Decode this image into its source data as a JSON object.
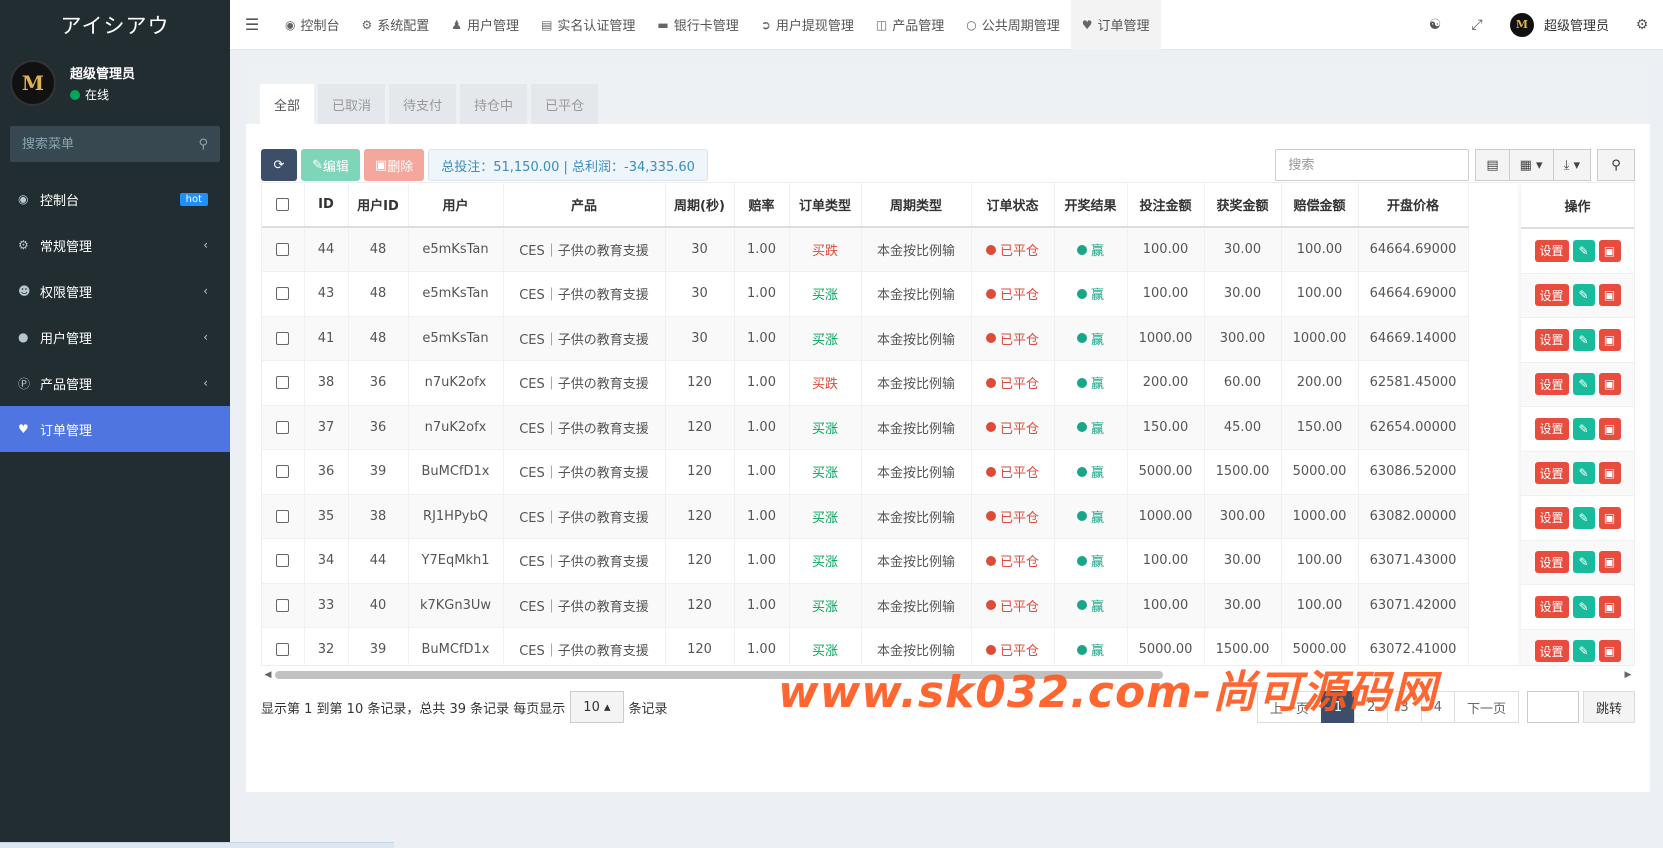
{
  "app": {
    "brand": "アイシアウ"
  },
  "sidebar": {
    "user": {
      "name": "超级管理员",
      "status": "在线",
      "avatar_letter": "M"
    },
    "search_placeholder": "搜索菜单",
    "items": [
      {
        "label": "控制台",
        "icon": "dashboard-icon",
        "badge": "hot"
      },
      {
        "label": "常规管理",
        "icon": "cogs-icon"
      },
      {
        "label": "权限管理",
        "icon": "users-icon"
      },
      {
        "label": "用户管理",
        "icon": "user-circle-icon"
      },
      {
        "label": "产品管理",
        "icon": "product-icon"
      },
      {
        "label": "订单管理",
        "icon": "heartbeat-icon",
        "active": true
      }
    ]
  },
  "topnav": {
    "tabs": [
      {
        "label": "控制台",
        "icon": "dashboard-icon"
      },
      {
        "label": "系统配置",
        "icon": "gear-icon"
      },
      {
        "label": "用户管理",
        "icon": "user-icon"
      },
      {
        "label": "实名认证管理",
        "icon": "id-card-icon"
      },
      {
        "label": "银行卡管理",
        "icon": "credit-card-icon"
      },
      {
        "label": "用户提现管理",
        "icon": "sign-out-icon"
      },
      {
        "label": "产品管理",
        "icon": "shopping-bag-icon"
      },
      {
        "label": "公共周期管理",
        "icon": "circle-icon"
      },
      {
        "label": "订单管理",
        "icon": "heartbeat-icon",
        "active": true
      }
    ],
    "user_name": "超级管理员"
  },
  "subtabs": [
    "全部",
    "已取消",
    "待支付",
    "持仓中",
    "已平仓"
  ],
  "toolbar": {
    "edit_label": "编辑",
    "delete_label": "删除",
    "summary": "总投注：51,150.00 | 总利润：-34,335.60",
    "search_placeholder": "搜索"
  },
  "table": {
    "columns": [
      "ID",
      "用户ID",
      "用户",
      "产品",
      "周期(秒)",
      "赔率",
      "订单类型",
      "周期类型",
      "订单状态",
      "开奖结果",
      "投注金额",
      "获奖金额",
      "赔偿金额",
      "开盘价格"
    ],
    "op_header": "操作",
    "op_set_label": "设置",
    "rows": [
      {
        "id": "44",
        "uid": "48",
        "user": "e5mKsTan",
        "product": "CES｜子供の教育支援",
        "period": "30",
        "odds": "1.00",
        "type": "买跌",
        "type_kind": "fall",
        "cycle": "本金按比例输",
        "status": "已平仓",
        "result": "赢",
        "bet": "100.00",
        "win": "30.00",
        "comp": "100.00",
        "open": "64664.69000"
      },
      {
        "id": "43",
        "uid": "48",
        "user": "e5mKsTan",
        "product": "CES｜子供の教育支援",
        "period": "30",
        "odds": "1.00",
        "type": "买涨",
        "type_kind": "rise",
        "cycle": "本金按比例输",
        "status": "已平仓",
        "result": "赢",
        "bet": "100.00",
        "win": "30.00",
        "comp": "100.00",
        "open": "64664.69000"
      },
      {
        "id": "41",
        "uid": "48",
        "user": "e5mKsTan",
        "product": "CES｜子供の教育支援",
        "period": "30",
        "odds": "1.00",
        "type": "买涨",
        "type_kind": "rise",
        "cycle": "本金按比例输",
        "status": "已平仓",
        "result": "赢",
        "bet": "1000.00",
        "win": "300.00",
        "comp": "1000.00",
        "open": "64669.14000"
      },
      {
        "id": "38",
        "uid": "36",
        "user": "n7uK2ofx",
        "product": "CES｜子供の教育支援",
        "period": "120",
        "odds": "1.00",
        "type": "买跌",
        "type_kind": "fall",
        "cycle": "本金按比例输",
        "status": "已平仓",
        "result": "赢",
        "bet": "200.00",
        "win": "60.00",
        "comp": "200.00",
        "open": "62581.45000"
      },
      {
        "id": "37",
        "uid": "36",
        "user": "n7uK2ofx",
        "product": "CES｜子供の教育支援",
        "period": "120",
        "odds": "1.00",
        "type": "买涨",
        "type_kind": "rise",
        "cycle": "本金按比例输",
        "status": "已平仓",
        "result": "赢",
        "bet": "150.00",
        "win": "45.00",
        "comp": "150.00",
        "open": "62654.00000"
      },
      {
        "id": "36",
        "uid": "39",
        "user": "BuMCfD1x",
        "product": "CES｜子供の教育支援",
        "period": "120",
        "odds": "1.00",
        "type": "买涨",
        "type_kind": "rise",
        "cycle": "本金按比例输",
        "status": "已平仓",
        "result": "赢",
        "bet": "5000.00",
        "win": "1500.00",
        "comp": "5000.00",
        "open": "63086.52000"
      },
      {
        "id": "35",
        "uid": "38",
        "user": "RJ1HPybQ",
        "product": "CES｜子供の教育支援",
        "period": "120",
        "odds": "1.00",
        "type": "买涨",
        "type_kind": "rise",
        "cycle": "本金按比例输",
        "status": "已平仓",
        "result": "赢",
        "bet": "1000.00",
        "win": "300.00",
        "comp": "1000.00",
        "open": "63082.00000"
      },
      {
        "id": "34",
        "uid": "44",
        "user": "Y7EqMkh1",
        "product": "CES｜子供の教育支援",
        "period": "120",
        "odds": "1.00",
        "type": "买涨",
        "type_kind": "rise",
        "cycle": "本金按比例输",
        "status": "已平仓",
        "result": "赢",
        "bet": "100.00",
        "win": "30.00",
        "comp": "100.00",
        "open": "63071.43000"
      },
      {
        "id": "33",
        "uid": "40",
        "user": "k7KGn3Uw",
        "product": "CES｜子供の教育支援",
        "period": "120",
        "odds": "1.00",
        "type": "买涨",
        "type_kind": "rise",
        "cycle": "本金按比例输",
        "status": "已平仓",
        "result": "赢",
        "bet": "100.00",
        "win": "30.00",
        "comp": "100.00",
        "open": "63071.42000"
      },
      {
        "id": "32",
        "uid": "39",
        "user": "BuMCfD1x",
        "product": "CES｜子供の教育支援",
        "period": "120",
        "odds": "1.00",
        "type": "买涨",
        "type_kind": "rise",
        "cycle": "本金按比例输",
        "status": "已平仓",
        "result": "赢",
        "bet": "5000.00",
        "win": "1500.00",
        "comp": "5000.00",
        "open": "63072.41000"
      }
    ]
  },
  "footer": {
    "info_prefix": "显示第 1 到第 10 条记录，总共 39 条记录 每页显示",
    "page_size": "10",
    "info_suffix": "条记录",
    "prev": "上一页",
    "pages": [
      "1",
      "2",
      "3",
      "4"
    ],
    "next": "下一页",
    "jump": "跳转"
  },
  "watermark": "www.sk032.com-尚可源码网",
  "colors": {
    "sidebar_bg": "#222d32",
    "active_menu": "#4f76e0",
    "fall": "#dd4b39",
    "rise": "#00a65a",
    "win": "#18a689"
  }
}
